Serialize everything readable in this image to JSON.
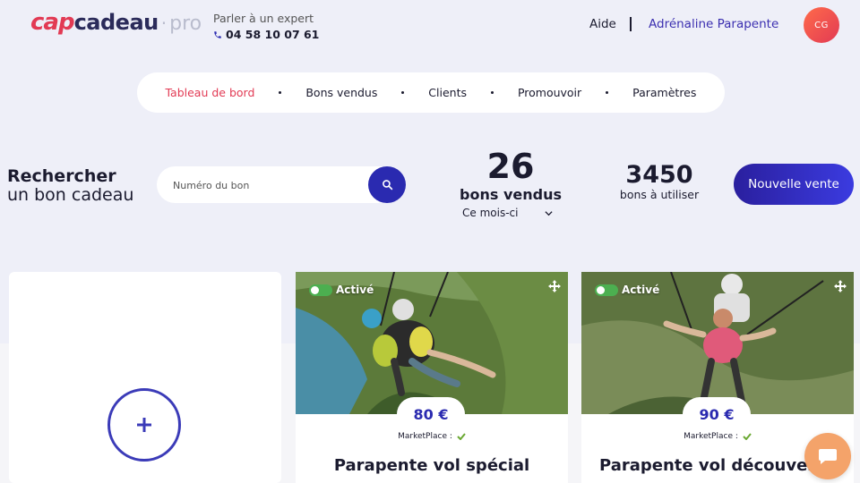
{
  "header": {
    "logo": {
      "cap": "cap",
      "cadeau": "cadeau",
      "dot": "·",
      "pro": "pro"
    },
    "expert_label": "Parler à un expert",
    "phone": "04 58 10 07 61",
    "help": "Aide",
    "company": "Adrénaline Parapente",
    "avatar_initials": "CG"
  },
  "nav": {
    "items": [
      {
        "label": "Tableau de bord",
        "active": true
      },
      {
        "label": "Bons vendus",
        "active": false
      },
      {
        "label": "Clients",
        "active": false
      },
      {
        "label": "Promouvoir",
        "active": false
      },
      {
        "label": "Paramètres",
        "active": false
      }
    ]
  },
  "search": {
    "title_line1": "Rechercher",
    "title_line2": "un bon cadeau",
    "placeholder": "Numéro du bon"
  },
  "stats": {
    "sold_count": "26",
    "sold_label": "bons vendus",
    "period": "Ce mois-ci",
    "to_use_count": "3450",
    "to_use_label": "bons à utiliser"
  },
  "new_sale_label": "Nouvelle vente",
  "cards": [
    {
      "status": "Activé",
      "price": "80 €",
      "marketplace": "MarketPlace :",
      "title": "Parapente vol spécial"
    },
    {
      "status": "Activé",
      "price": "90 €",
      "marketplace": "MarketPlace :",
      "title": "Parapente vol découver"
    }
  ],
  "colors": {
    "accent": "#2a2ab0",
    "brand_red": "#e23a54",
    "background": "#eeeff8",
    "toggle_on": "#4caf50",
    "chat": "#f4a36a"
  },
  "icons": [
    "phone-icon",
    "search-icon",
    "chevron-down-icon",
    "plus-icon",
    "move-icon",
    "check-icon",
    "chat-icon"
  ]
}
